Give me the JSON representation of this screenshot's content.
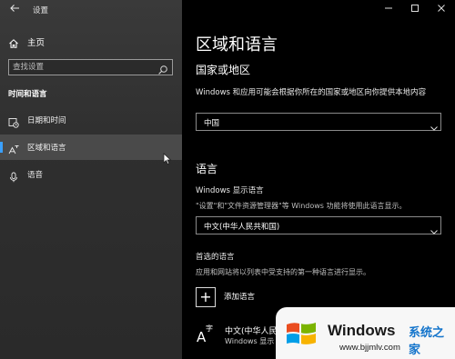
{
  "window": {
    "title": "设置",
    "back_icon": "back-arrow-icon"
  },
  "sidebar": {
    "home": {
      "label": "主页",
      "icon": "home-icon"
    },
    "search": {
      "placeholder": "查找设置",
      "icon": "search-icon"
    },
    "section_header": "时间和语言",
    "items": [
      {
        "label": "日期和时间",
        "icon": "calendar-clock-icon",
        "selected": false
      },
      {
        "label": "区域和语言",
        "icon": "region-language-icon",
        "selected": true
      },
      {
        "label": "语音",
        "icon": "microphone-icon",
        "selected": false
      }
    ],
    "accent_color": "#3aa0ff"
  },
  "main": {
    "title": "区域和语言",
    "country": {
      "heading": "国家或地区",
      "description": "Windows 和应用可能会根据你所在的国家或地区向你提供本地内容",
      "selected": "中国"
    },
    "language": {
      "heading": "语言",
      "display_label": "Windows 显示语言",
      "display_description": "\"设置\"和\"文件资源管理器\"等 Windows 功能将使用此语言显示。",
      "display_selected": "中文(中华人民共和国)",
      "preferred_heading": "首选的语言",
      "preferred_description": "应用和网站将以列表中受支持的第一种语言进行显示。",
      "add_label": "添加语言",
      "installed": [
        {
          "name": "中文(中华人民",
          "sub": "Windows 显示"
        }
      ]
    }
  },
  "window_controls": [
    "minimize-icon",
    "maximize-icon",
    "close-icon"
  ],
  "watermark": {
    "brand": "Windows",
    "suffix": "系统之家",
    "url": "www.bjjmlv.com",
    "colors": {
      "red": "#f25022",
      "green": "#7fba00",
      "blue": "#00a4ef",
      "yellow": "#ffb900",
      "text_blue": "#1478d2"
    }
  }
}
